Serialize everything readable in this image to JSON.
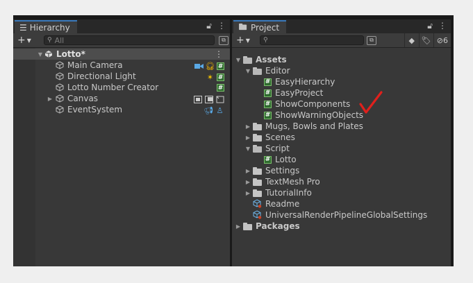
{
  "hierarchy": {
    "tab_title": "Hierarchy",
    "search_placeholder": "All",
    "scene": "Lotto*",
    "items": [
      {
        "label": "Main Camera"
      },
      {
        "label": "Directional Light"
      },
      {
        "label": "Lotto Number Creator"
      },
      {
        "label": "Canvas"
      },
      {
        "label": "EventSystem"
      }
    ]
  },
  "project": {
    "tab_title": "Project",
    "hidden_count": "6",
    "tree": {
      "assets": "Assets",
      "editor": "Editor",
      "editor_scripts": [
        "EasyHierarchy",
        "EasyProject",
        "ShowComponents",
        "ShowWarningObjects"
      ],
      "mugs": "Mugs, Bowls and Plates",
      "scenes": "Scenes",
      "script": "Script",
      "lotto": "Lotto",
      "settings": "Settings",
      "textmesh": "TextMesh Pro",
      "tutorial": "TutorialInfo",
      "readme": "Readme",
      "urp": "UniversalRenderPipelineGlobalSettings",
      "packages": "Packages"
    }
  },
  "colors": {
    "accent": "#3a79bb",
    "script_green": "#2f6b2f",
    "check_red": "#e0201c"
  }
}
